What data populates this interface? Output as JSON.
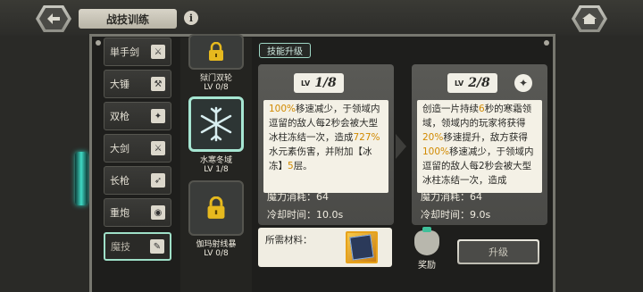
{
  "header": {
    "title": "战技训练",
    "info_glyph": "i"
  },
  "categories": [
    {
      "label": "単手剑",
      "icon": "sword-icon",
      "active": false
    },
    {
      "label": "大锤",
      "icon": "hammer-icon",
      "active": false
    },
    {
      "label": "双枪",
      "icon": "dual-guns-icon",
      "active": false
    },
    {
      "label": "大剑",
      "icon": "greatsword-icon",
      "active": false
    },
    {
      "label": "长枪",
      "icon": "spear-icon",
      "active": false
    },
    {
      "label": "重炮",
      "icon": "cannon-icon",
      "active": false
    },
    {
      "label": "魔技",
      "icon": "magic-scroll-icon",
      "active": true
    }
  ],
  "skills": [
    {
      "name": "狱门双轮",
      "level": "LV 0/8",
      "locked": true,
      "selected": false
    },
    {
      "name": "水寒冬域",
      "level": "LV 1/8",
      "locked": false,
      "selected": true
    },
    {
      "name": "伽玛射线暴",
      "level": "LV 0/8",
      "locked": true,
      "selected": false
    }
  ],
  "tab_label": "技能升级",
  "current": {
    "lv_prefix": "LV",
    "lv_value": "1/8",
    "desc_parts": [
      {
        "t": "100%",
        "h": true
      },
      {
        "t": "移速减少，于领域内逗留的敌人每2秒会被大型冰柱冻结一次，造成",
        "h": false
      },
      {
        "t": "727%",
        "h": true
      },
      {
        "t": "水元素伤害，并附加【冰冻】",
        "h": false
      },
      {
        "t": "5",
        "h": true
      },
      {
        "t": "层。",
        "h": false
      }
    ],
    "mana_cost": "魔力消耗：64",
    "cooldown": "冷却时间：10.0s"
  },
  "next": {
    "lv_prefix": "LV",
    "lv_value": "2/8",
    "desc_parts": [
      {
        "t": "创造一片持续",
        "h": false
      },
      {
        "t": "6",
        "h": true
      },
      {
        "t": "秒的寒霜领域，领域内的玩家将获得",
        "h": false
      },
      {
        "t": "20%",
        "h": true
      },
      {
        "t": "移速提升，敌方获得",
        "h": false
      },
      {
        "t": "100%",
        "h": true
      },
      {
        "t": "移速减少，于领域内逗留的敌人每2秒会被大型冰柱冻结一次，造成",
        "h": false
      }
    ],
    "mana_cost": "魔力消耗：64",
    "cooldown": "冷却时间：9.0s"
  },
  "materials_label": "所需材料：",
  "reward_label": "奖励",
  "upgrade_button": "升级",
  "colors": {
    "highlight": "#d18a00",
    "accent_teal": "#9fe0c8"
  }
}
